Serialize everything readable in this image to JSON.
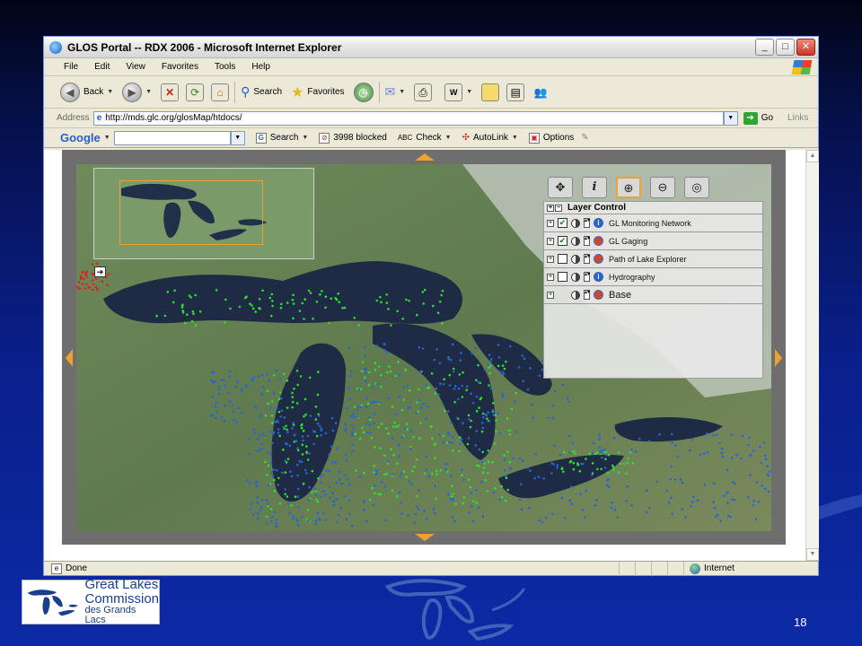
{
  "window": {
    "title": "GLOS Portal -- RDX 2006 - Microsoft Internet Explorer",
    "controls": {
      "minimize": "_",
      "maximize": "□",
      "close": "✕"
    }
  },
  "menu": [
    "File",
    "Edit",
    "View",
    "Favorites",
    "Tools",
    "Help"
  ],
  "toolbar": {
    "back": "Back",
    "search": "Search",
    "favorites": "Favorites"
  },
  "address": {
    "label": "Address",
    "url": "http://mds.glc.org/glosMap/htdocs/",
    "go": "Go",
    "links": "Links"
  },
  "google_bar": {
    "logo": "Google",
    "search": "Search",
    "blocked": "3998 blocked",
    "check": "Check",
    "autolink": "AutoLink",
    "options": "Options"
  },
  "map": {
    "tools": [
      "pan-icon",
      "info-icon",
      "zoom-in-icon",
      "zoom-out-icon",
      "full-extent-icon"
    ],
    "info_tool_label": "i",
    "active_tool": "zoom-in-icon",
    "overview_toggle": "➔",
    "layer_control": {
      "title": "Layer Control",
      "layers": [
        {
          "name": "GL Monitoring Network",
          "checked": true
        },
        {
          "name": "GL Gaging",
          "checked": true
        },
        {
          "name": "Path of Lake Explorer",
          "checked": false
        },
        {
          "name": "Hydrography",
          "checked": false
        },
        {
          "name": "Base",
          "checked": null
        }
      ]
    }
  },
  "status": {
    "text": "Done",
    "zone": "Internet"
  },
  "slide": {
    "logo_line1": "Great Lakes",
    "logo_line2": "Commission",
    "logo_line3": "des Grands Lacs",
    "page_number": "18"
  },
  "colors": {
    "accent_orange": "#f0a030",
    "point_green": "#2fe02f",
    "point_blue": "#2a63d8",
    "slide_blue": "#0c2aa6"
  }
}
